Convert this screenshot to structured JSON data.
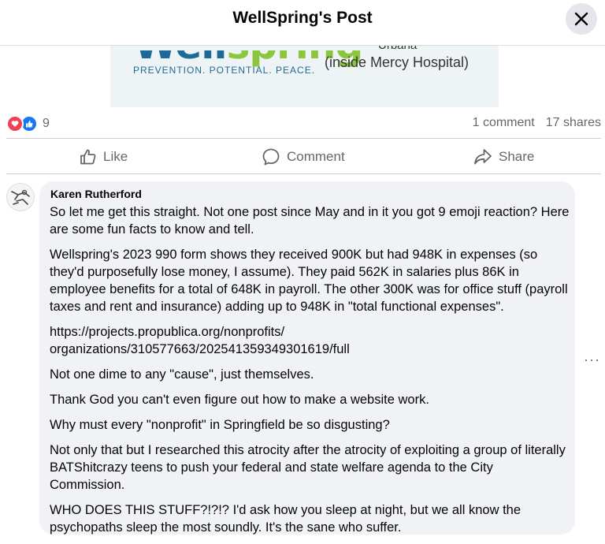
{
  "header": {
    "title": "WellSpring's Post"
  },
  "banner": {
    "logo_left": "Well",
    "logo_right": "spring",
    "tagline": "PREVENTION. POTENTIAL. PEACE.",
    "city": "Urbana",
    "location": "(inside Mercy Hospital)"
  },
  "stats": {
    "reactions": "9",
    "comments": "1 comment",
    "shares": "17 shares"
  },
  "actions": {
    "like": "Like",
    "comment": "Comment",
    "share": "Share"
  },
  "comment": {
    "author": "Karen Rutherford",
    "paragraphs": [
      "So let me get this straight. Not one post since May and in it you got 9 emoji reaction? Here are some fun facts to know and tell.",
      "Wellspring's 2023 990 form shows they received 900K but had 948K in expenses (so they'd purposefully lose money, I assume). They paid 562K in salaries plus 86K in employee benefits for a total of 648K in payroll. The other 300K was for office stuff (payroll taxes and rent and insurance) adding up to 948K in \"total functional expenses\".",
      "https://projects.propublica.org/nonprofits/\norganizations/310577663/202541359349301619/full",
      "Not one dime to any \"cause\", just themselves.",
      "Thank God you can't even figure out how to make a website work.",
      "Why must every \"nonprofit\" in Springfield be so disgusting?",
      "Not only that but I researched this atrocity after the atrocity of exploiting a group of literally BATShitcrazy teens to push your federal and state welfare agenda to the City Commission.",
      "WHO DOES THIS STUFF?!?!? I'd ask how you sleep at night, but we all know the psychopaths sleep the most soundly. It's the sane who suffer."
    ],
    "more": "···"
  }
}
